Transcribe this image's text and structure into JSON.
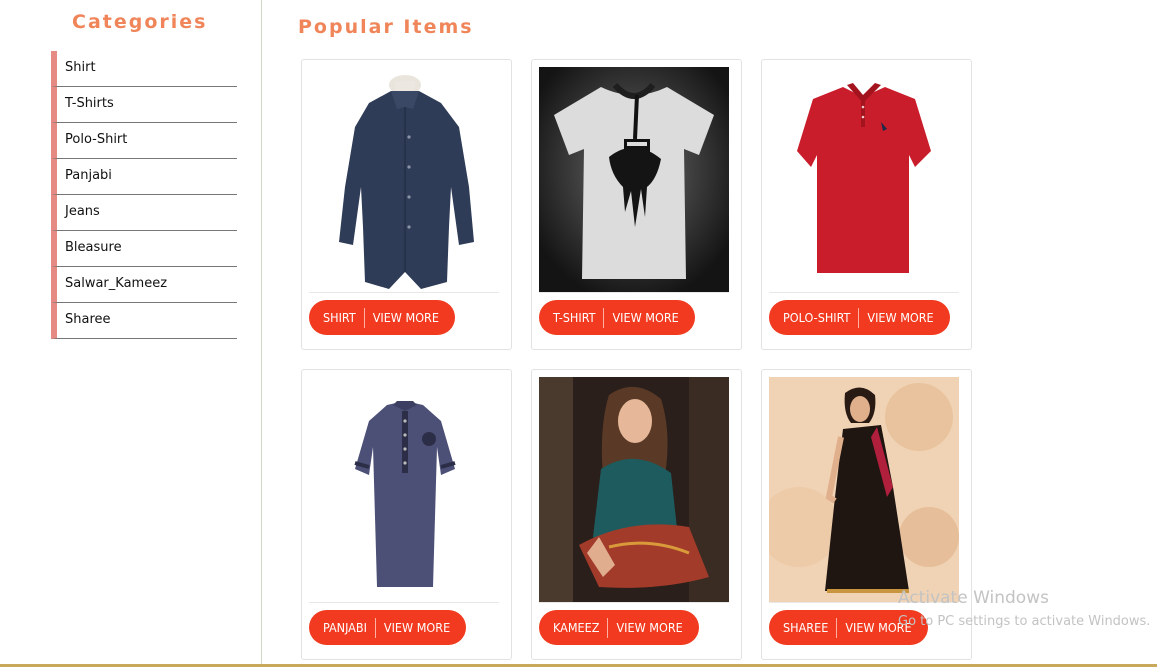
{
  "sidebar": {
    "title": "Categories",
    "items": [
      {
        "label": "Shirt"
      },
      {
        "label": "T-Shirts"
      },
      {
        "label": "Polo-Shirt"
      },
      {
        "label": "Panjabi"
      },
      {
        "label": "Jeans"
      },
      {
        "label": "Bleasure"
      },
      {
        "label": "Salwar_Kameez"
      },
      {
        "label": "Sharee"
      }
    ]
  },
  "main": {
    "title": "Popular Items",
    "view_more_label": "VIEW MORE",
    "items": [
      {
        "category": "SHIRT",
        "image": "navy-dress-shirt"
      },
      {
        "category": "T-SHIRT",
        "image": "white-graphic-tshirt"
      },
      {
        "category": "POLO-SHIRT",
        "image": "red-polo-shirt"
      },
      {
        "category": "PANJABI",
        "image": "blue-panjabi"
      },
      {
        "category": "KAMEEZ",
        "image": "woman-in-kameez"
      },
      {
        "category": "SHAREE",
        "image": "woman-in-black-sharee"
      }
    ]
  },
  "watermark": {
    "line1": "Activate Windows",
    "line2": "Go to PC settings to activate Windows."
  },
  "colors": {
    "accent": "#f13a1f",
    "heading": "#f0855a",
    "sidebar_marker": "#e68a84"
  }
}
